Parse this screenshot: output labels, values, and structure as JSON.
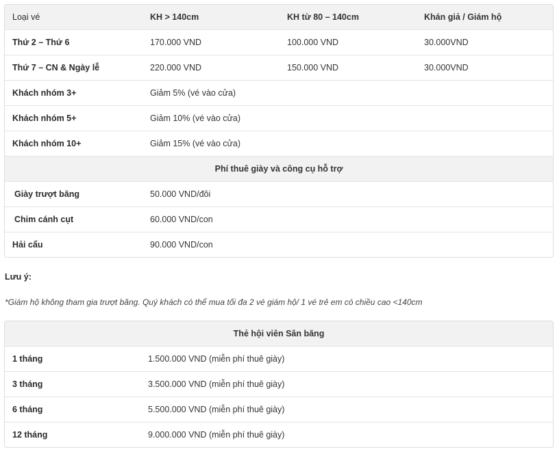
{
  "price_table": {
    "headers": [
      "Loại vé",
      "KH > 140cm",
      "KH từ 80 – 140cm",
      "Khán giả / Giám hộ"
    ],
    "rows": [
      {
        "label": "Thứ 2 – Thứ 6",
        "adult": "170.000 VND",
        "child": "100.000 VND",
        "guardian": "30.000VND"
      },
      {
        "label": "Thứ 7 – CN & Ngày lễ",
        "adult": "220.000 VND",
        "child": "150.000 VND",
        "guardian": "30.000VND"
      }
    ],
    "groups": [
      {
        "label": "Khách nhóm 3+",
        "value": "Giảm 5% (vé vào cửa)"
      },
      {
        "label": "Khách nhóm 5+",
        "value": "Giảm 10% (vé vào cửa)"
      },
      {
        "label": "Khách nhóm 10+",
        "value": "Giảm 15% (vé vào cửa)"
      }
    ],
    "rental_header": "Phí thuê giày và công cụ hỗ trợ",
    "rentals": [
      {
        "label": "Giày trượt băng",
        "value": "50.000 VND/đôi"
      },
      {
        "label": "Chim cánh cụt",
        "value": "60.000 VND/con"
      },
      {
        "label": "Hải cẩu",
        "value": "90.000 VND/con"
      }
    ]
  },
  "note": {
    "title": "Lưu ý:",
    "text": "*Giám hộ không tham gia trượt băng. Quý khách có thể mua tối đa 2 vé giám hộ/ 1 vé trẻ em có chiều cao <140cm"
  },
  "membership_table": {
    "header": "Thẻ hội viên Sân băng",
    "rows": [
      {
        "label": "1 tháng",
        "value": "1.500.000 VND (miễn phí thuê giày)"
      },
      {
        "label": "3 tháng",
        "value": "3.500.000 VND (miễn phí thuê giày)"
      },
      {
        "label": "6 tháng",
        "value": "5.500.000 VND (miễn phí thuê giày)"
      },
      {
        "label": "12 tháng",
        "value": "9.000.000 VND (miễn phí thuê giày)"
      }
    ]
  }
}
